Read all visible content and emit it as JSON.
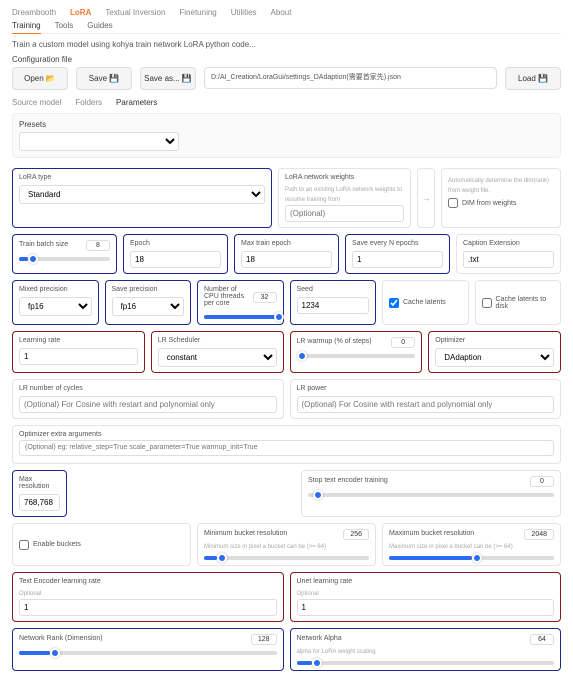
{
  "topnav": [
    "Dreambooth",
    "LoRA",
    "Textual Inversion",
    "Finetuning",
    "Utilities",
    "About"
  ],
  "topnav_active": 1,
  "subnav": [
    "Training",
    "Tools",
    "Guides"
  ],
  "subnav_active": 0,
  "description": "Train a custom model using kohya train network LoRA python code...",
  "config_section": "Configuration file",
  "buttons": {
    "open": "Open 📂",
    "save": "Save 💾",
    "saveas": "Save as... 💾",
    "load": "Load 💾"
  },
  "config_path": "D:/AI_Creation/LoraGui/settings_DAdaption(需要首家先).json",
  "tabs3": [
    "Source model",
    "Folders",
    "Parameters"
  ],
  "tabs3_active": 2,
  "presets_label": "Presets",
  "lora_type": {
    "label": "LoRA type",
    "value": "Standard"
  },
  "network_weights": {
    "label": "LoRA network weights",
    "sub": "Path to an existing LoRA network weights to resume training from",
    "placeholder": "(Optional)"
  },
  "dim_auto": {
    "sub": "Automatically determine the dim(rank) from weight file.",
    "label": "DIM from weights"
  },
  "train_batch": {
    "label": "Train batch size",
    "value": "8"
  },
  "epoch": {
    "label": "Epoch",
    "value": "18"
  },
  "max_epoch": {
    "label": "Max train epoch",
    "value": "18"
  },
  "save_n": {
    "label": "Save every N epochs",
    "value": "1"
  },
  "caption_ext": {
    "label": "Caption Extension",
    "value": ".txt"
  },
  "mixed_prec": {
    "label": "Mixed precision",
    "value": "fp16"
  },
  "save_prec": {
    "label": "Save precision",
    "value": "fp16"
  },
  "cpu_threads": {
    "label": "Number of CPU threads per core",
    "value": "32"
  },
  "seed": {
    "label": "Seed",
    "value": "1234"
  },
  "cache_latents": "Cache latents",
  "cache_disk": "Cache latents to disk",
  "learning_rate": {
    "label": "Learning rate",
    "value": "1"
  },
  "lr_sched": {
    "label": "LR Scheduler",
    "value": "constant"
  },
  "lr_warmup": {
    "label": "LR warmup (% of steps)",
    "value": "0"
  },
  "optimizer": {
    "label": "Optimizer",
    "value": "DAdaption"
  },
  "lr_cycles": {
    "label": "LR number of cycles",
    "placeholder": "(Optional) For Cosine with restart and polynomial only"
  },
  "lr_power": {
    "label": "LR power",
    "placeholder": "(Optional) For Cosine with restart and polynomial only"
  },
  "opt_extra": {
    "label": "Optimizer extra arguments",
    "placeholder": "(Optional) eg: relative_step=True scale_parameter=True warmup_init=True"
  },
  "max_res": {
    "label": "Max resolution",
    "value": "768,768"
  },
  "stop_te": {
    "label": "Stop text encoder training",
    "value": "0"
  },
  "enable_buckets": "Enable buckets",
  "min_bucket": {
    "label": "Minimum bucket resolution",
    "sub": "Minimum size in pixel a bucket can be (>= 64)",
    "value": "256"
  },
  "max_bucket": {
    "label": "Maximum bucket resolution",
    "sub": "Maximum size in pixel a bucket can be (>= 64)",
    "value": "2048"
  },
  "te_lr": {
    "label": "Text Encoder learning rate",
    "sub": "Optional",
    "value": "1"
  },
  "unet_lr": {
    "label": "Unet learning rate",
    "sub": "Optional",
    "value": "1"
  },
  "net_rank": {
    "label": "Network Rank (Dimension)",
    "value": "128"
  },
  "net_alpha": {
    "label": "Network Alpha",
    "sub": "alpha for LoRA weight scaling",
    "value": "64"
  }
}
